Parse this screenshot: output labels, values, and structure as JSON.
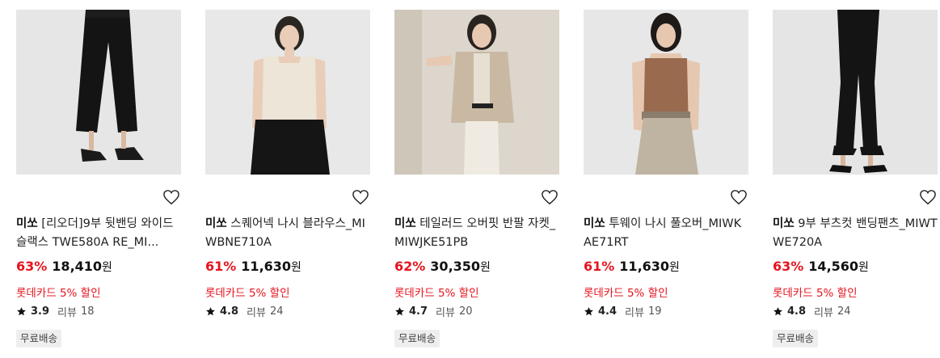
{
  "products": [
    {
      "image_icon": "product-photo-wide-slacks",
      "brand": "미쏘",
      "name": "[리오더]9부 뒷밴딩 와이드 슬랙스 TWE580A RE_MI...",
      "discount": "63%",
      "price": "18,410",
      "currency": "원",
      "promo": "롯데카드 5% 할인",
      "rating": "3.9",
      "review_label": "리뷰",
      "review_count": "18",
      "badge": "무료배송"
    },
    {
      "image_icon": "product-photo-sleeveless-blouse",
      "brand": "미쏘",
      "name": "스퀘어넥 나시 블라우스_MIWBNE710A",
      "discount": "61%",
      "price": "11,630",
      "currency": "원",
      "promo": "롯데카드 5% 할인",
      "rating": "4.8",
      "review_label": "리뷰",
      "review_count": "24",
      "badge": ""
    },
    {
      "image_icon": "product-photo-tailored-jacket",
      "brand": "미쏘",
      "name": "테일러드 오버핏 반팔 자켓_MIWJKE51PB",
      "discount": "62%",
      "price": "30,350",
      "currency": "원",
      "promo": "롯데카드 5% 할인",
      "rating": "4.7",
      "review_label": "리뷰",
      "review_count": "20",
      "badge": "무료배송"
    },
    {
      "image_icon": "product-photo-two-way-knit",
      "brand": "미쏘",
      "name": "투웨이 나시 풀오버_MIWKAE71RT",
      "discount": "61%",
      "price": "11,630",
      "currency": "원",
      "promo": "롯데카드 5% 할인",
      "rating": "4.4",
      "review_label": "리뷰",
      "review_count": "19",
      "badge": ""
    },
    {
      "image_icon": "product-photo-bootcut-pants",
      "brand": "미쏘",
      "name": "9부 부츠컷 밴딩팬츠_MIWTWE720A",
      "discount": "63%",
      "price": "14,560",
      "currency": "원",
      "promo": "롯데카드 5% 할인",
      "rating": "4.8",
      "review_label": "리뷰",
      "review_count": "24",
      "badge": "무료배송"
    }
  ],
  "colors": {
    "discount": "#e5141e",
    "promo": "#e5141e",
    "badge_bg": "#eeeeee"
  }
}
